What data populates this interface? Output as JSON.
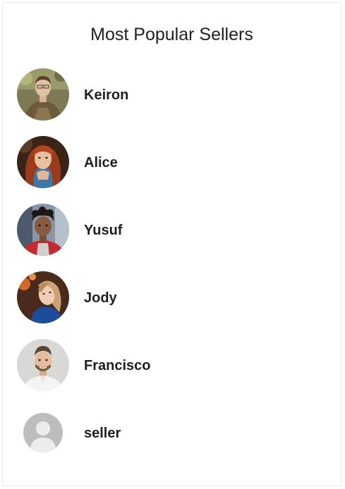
{
  "widget": {
    "title": "Most Popular Sellers"
  },
  "sellers": [
    {
      "name": "Keiron",
      "avatar": "photo-avatar"
    },
    {
      "name": "Alice",
      "avatar": "photo-avatar"
    },
    {
      "name": "Yusuf",
      "avatar": "photo-avatar"
    },
    {
      "name": "Jody",
      "avatar": "photo-avatar"
    },
    {
      "name": "Francisco",
      "avatar": "photo-avatar"
    },
    {
      "name": "seller",
      "avatar": "default-user-icon"
    }
  ],
  "colors": {
    "text": "#1f1f1f",
    "card_border": "#ece6e3",
    "default_avatar": "#bdbdbd"
  }
}
